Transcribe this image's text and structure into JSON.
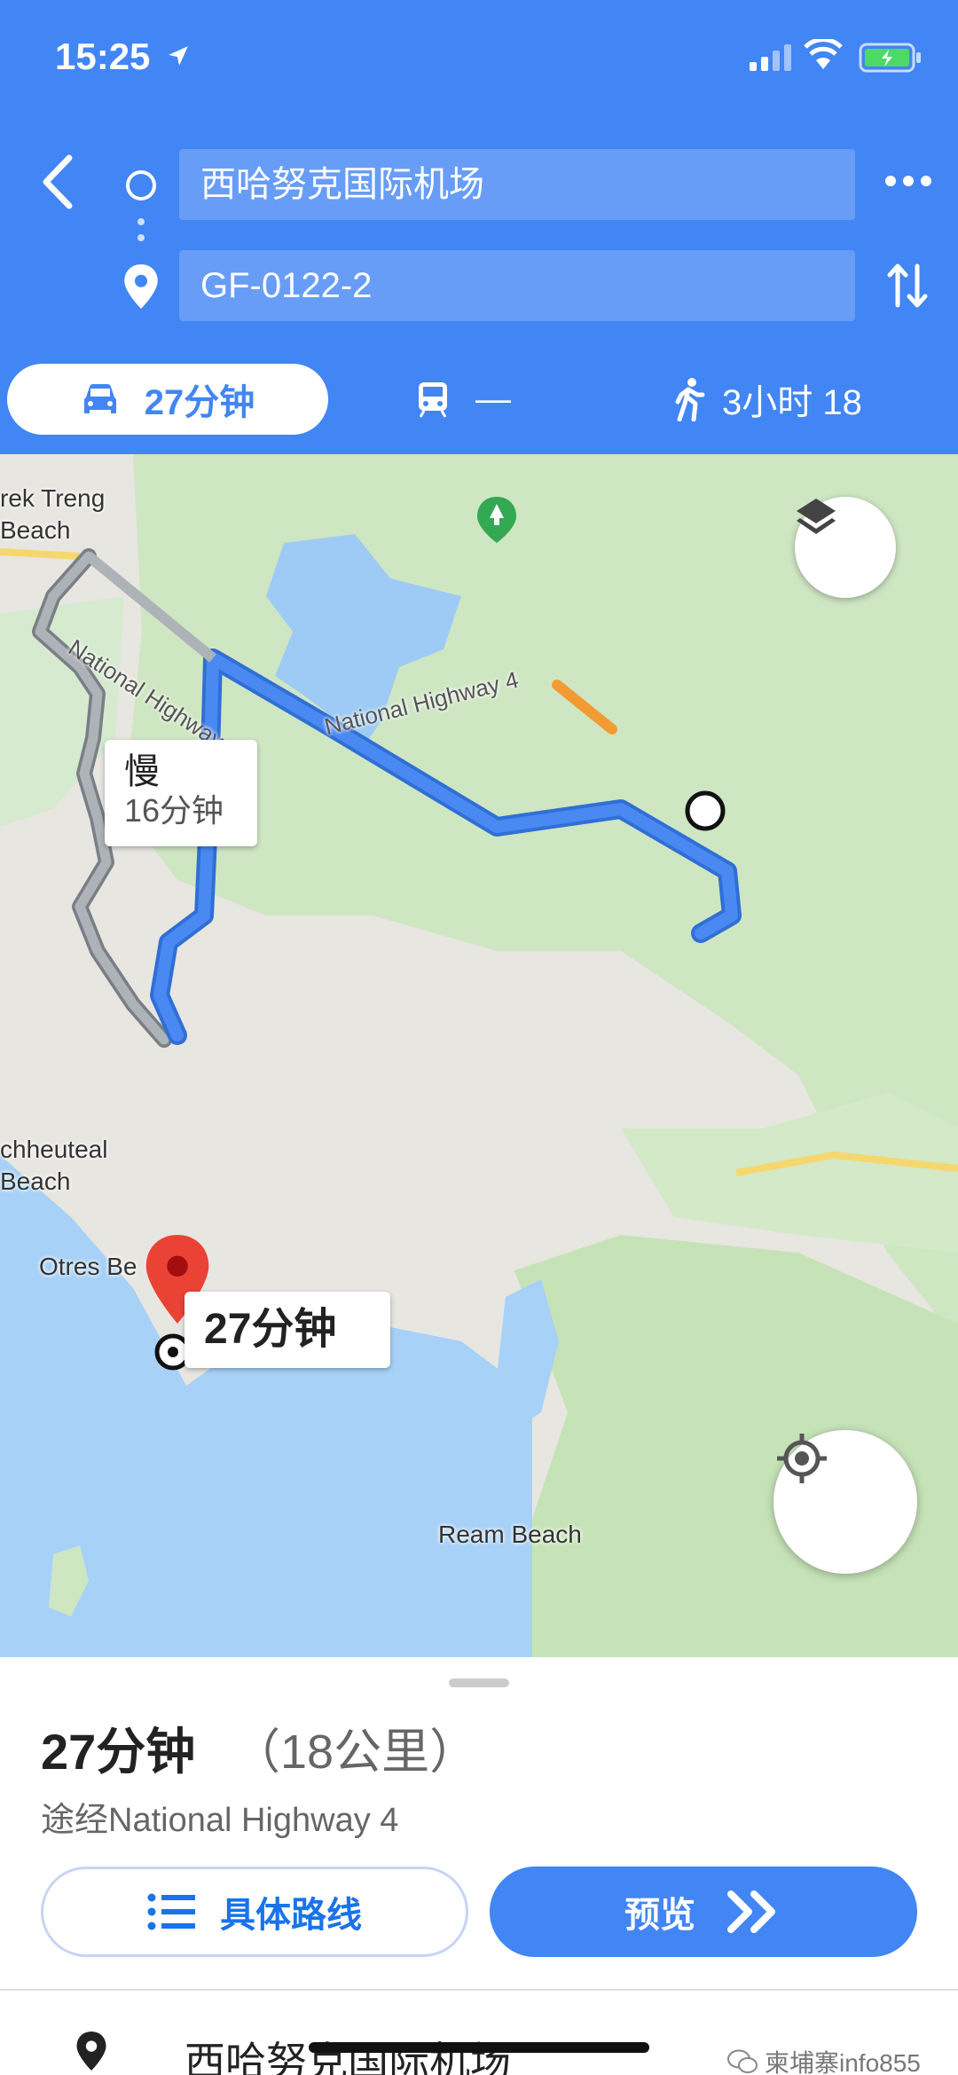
{
  "status_bar": {
    "time": "15:25"
  },
  "directions": {
    "origin": "西哈努克国际机场",
    "destination": "GF-0122-2"
  },
  "modes": {
    "drive": "27分钟",
    "transit": "—",
    "walk": "3小时 18"
  },
  "map": {
    "labels": {
      "prek_treng": "rek Treng\nBeach",
      "cheuteal": "chheuteal\nBeach",
      "otres": "Otres Be",
      "ream": "Ream Beach",
      "highway_1": "National Highway 4",
      "highway_2": "National Highway 4"
    },
    "slow_callout": {
      "title": "慢",
      "time": "16分钟"
    },
    "eta_callout": "27分钟"
  },
  "sheet": {
    "duration": "27分钟",
    "distance": "（18公里）",
    "via": "途经National Highway 4",
    "steps_button": "具体路线",
    "preview_button": "预览",
    "first_step": "西哈努克国际机场",
    "watermark": "柬埔寨info855"
  },
  "colors": {
    "accent": "#4285F4",
    "route": "#4a89f2",
    "route_alt": "#9aa0a6",
    "traffic_slow": "#f29b33",
    "pin": "#ea4335"
  }
}
